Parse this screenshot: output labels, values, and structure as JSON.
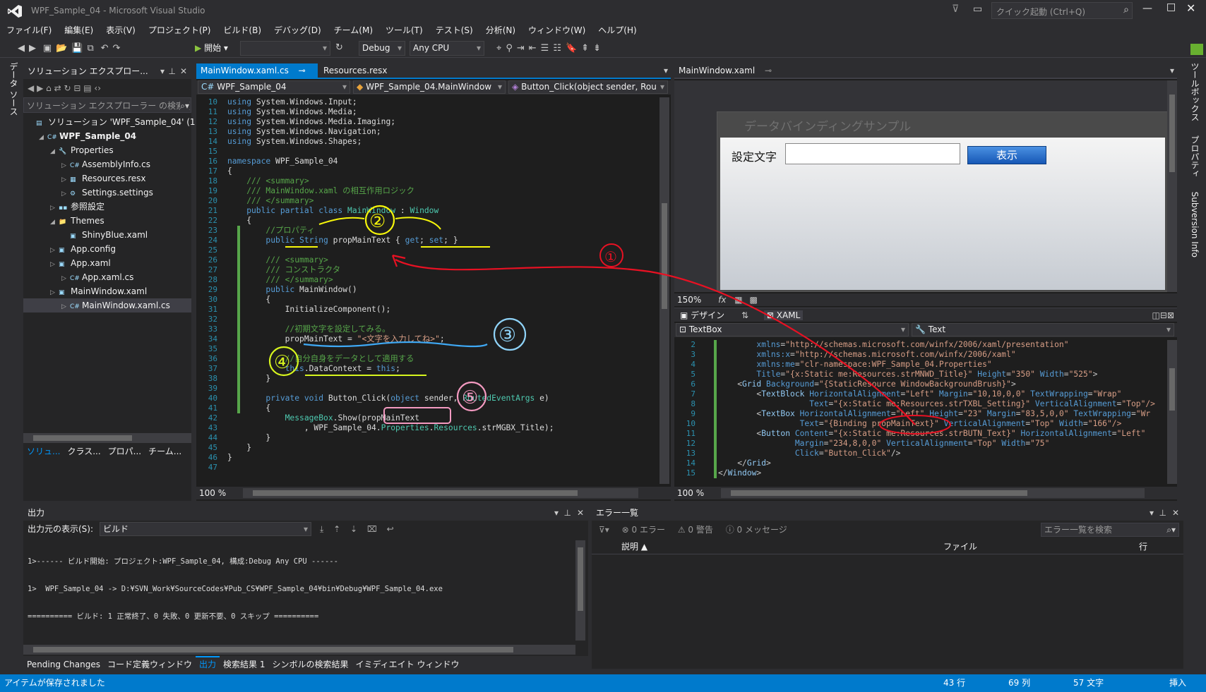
{
  "window": {
    "title": "WPF_Sample_04 - Microsoft Visual Studio",
    "quick_launch": "クイック起動 (Ctrl+Q)"
  },
  "menu": [
    "ファイル(F)",
    "編集(E)",
    "表示(V)",
    "プロジェクト(P)",
    "ビルド(B)",
    "デバッグ(D)",
    "チーム(M)",
    "ツール(T)",
    "テスト(S)",
    "分析(N)",
    "ウィンドウ(W)",
    "ヘルプ(H)"
  ],
  "toolbar": {
    "start_label": "開始",
    "config": "Debug",
    "platform": "Any CPU"
  },
  "left_rail": {
    "label": "データ ソース"
  },
  "right_rail": {
    "toolbox": "ツールボックス",
    "properties": "プロパティ",
    "svn": "Subversion Info"
  },
  "solution_explorer": {
    "title": "ソリューション エクスプロー...",
    "search_placeholder": "ソリューション エクスプローラー の検索 (Ctrl+;)",
    "items": [
      {
        "label": "ソリューション 'WPF_Sample_04' (1 プロジェクト)",
        "indent": 0,
        "icon": "solution-icon"
      },
      {
        "label": "WPF_Sample_04",
        "indent": 1,
        "icon": "csharp-project-icon",
        "bold": true
      },
      {
        "label": "Properties",
        "indent": 2,
        "icon": "wrench-icon"
      },
      {
        "label": "AssemblyInfo.cs",
        "indent": 3,
        "icon": "cs-file-icon"
      },
      {
        "label": "Resources.resx",
        "indent": 3,
        "icon": "resx-file-icon"
      },
      {
        "label": "Settings.settings",
        "indent": 3,
        "icon": "settings-file-icon"
      },
      {
        "label": "参照設定",
        "indent": 2,
        "icon": "references-icon"
      },
      {
        "label": "Themes",
        "indent": 2,
        "icon": "folder-icon"
      },
      {
        "label": "ShinyBlue.xaml",
        "indent": 3,
        "icon": "xaml-file-icon"
      },
      {
        "label": "App.config",
        "indent": 2,
        "icon": "config-file-icon"
      },
      {
        "label": "App.xaml",
        "indent": 2,
        "icon": "xaml-file-icon"
      },
      {
        "label": "App.xaml.cs",
        "indent": 3,
        "icon": "cs-file-icon"
      },
      {
        "label": "MainWindow.xaml",
        "indent": 2,
        "icon": "xaml-file-icon"
      },
      {
        "label": "MainWindow.xaml.cs",
        "indent": 3,
        "icon": "cs-file-icon",
        "selected": true
      }
    ],
    "bottom_tabs": [
      "ソリュ...",
      "クラス...",
      "プロパ...",
      "チーム..."
    ]
  },
  "editor": {
    "tabs": [
      {
        "label": "MainWindow.xaml.cs",
        "active": true
      },
      {
        "label": "Resources.resx",
        "active": false
      }
    ],
    "nav": {
      "project": "WPF_Sample_04",
      "type": "WPF_Sample_04.MainWindow",
      "member": "Button_Click(object sender, Rou"
    },
    "zoom": "100 %",
    "lines": [
      {
        "n": "10",
        "t": [
          [
            "kw",
            "using"
          ],
          [
            "tx",
            " System.Windows.Input;"
          ]
        ]
      },
      {
        "n": "11",
        "t": [
          [
            "kw",
            "using"
          ],
          [
            "tx",
            " System.Windows.Media;"
          ]
        ]
      },
      {
        "n": "12",
        "t": [
          [
            "kw",
            "using"
          ],
          [
            "tx",
            " System.Windows.Media.Imaging;"
          ]
        ]
      },
      {
        "n": "13",
        "t": [
          [
            "kw",
            "using"
          ],
          [
            "tx",
            " System.Windows.Navigation;"
          ]
        ]
      },
      {
        "n": "14",
        "t": [
          [
            "kw",
            "using"
          ],
          [
            "tx",
            " System.Windows.Shapes;"
          ]
        ]
      },
      {
        "n": "15",
        "t": []
      },
      {
        "n": "16",
        "t": [
          [
            "kw",
            "namespace"
          ],
          [
            "tx",
            " WPF_Sample_04"
          ]
        ]
      },
      {
        "n": "17",
        "t": [
          [
            "tx",
            "{"
          ]
        ]
      },
      {
        "n": "18",
        "t": [
          [
            "cm",
            "    /// <summary>"
          ]
        ]
      },
      {
        "n": "19",
        "t": [
          [
            "cm",
            "    /// MainWindow.xaml の相互作用ロジック"
          ]
        ]
      },
      {
        "n": "20",
        "t": [
          [
            "cm",
            "    /// </summary>"
          ]
        ]
      },
      {
        "n": "21",
        "t": [
          [
            "kw",
            "    public partial class "
          ],
          [
            "ty",
            "MainWindow"
          ],
          [
            "tx",
            " : "
          ],
          [
            "ty",
            "Window"
          ]
        ]
      },
      {
        "n": "22",
        "t": [
          [
            "tx",
            "    {"
          ]
        ]
      },
      {
        "n": "23",
        "t": [
          [
            "cm",
            "        //プロパティ"
          ]
        ]
      },
      {
        "n": "24",
        "t": [
          [
            "kw",
            "        public "
          ],
          [
            "kw",
            "String"
          ],
          [
            "tx",
            " propMainText { "
          ],
          [
            "kw",
            "get"
          ],
          [
            "tx",
            "; "
          ],
          [
            "kw",
            "set"
          ],
          [
            "tx",
            "; }"
          ]
        ]
      },
      {
        "n": "25",
        "t": []
      },
      {
        "n": "26",
        "t": [
          [
            "cm",
            "        /// <summary>"
          ]
        ]
      },
      {
        "n": "27",
        "t": [
          [
            "cm",
            "        /// コンストラクタ"
          ]
        ]
      },
      {
        "n": "28",
        "t": [
          [
            "cm",
            "        /// </summary>"
          ]
        ]
      },
      {
        "n": "29",
        "t": [
          [
            "kw",
            "        public "
          ],
          [
            "tx",
            "MainWindow()"
          ]
        ]
      },
      {
        "n": "30",
        "t": [
          [
            "tx",
            "        {"
          ]
        ]
      },
      {
        "n": "31",
        "t": [
          [
            "tx",
            "            InitializeComponent();"
          ]
        ]
      },
      {
        "n": "32",
        "t": []
      },
      {
        "n": "33",
        "t": [
          [
            "cm",
            "            //初期文字を設定してみる。"
          ]
        ]
      },
      {
        "n": "34",
        "t": [
          [
            "tx",
            "            propMainText = "
          ],
          [
            "st",
            "\"<文字を入力してね>\""
          ],
          [
            "tx",
            ";"
          ]
        ]
      },
      {
        "n": "35",
        "t": []
      },
      {
        "n": "36",
        "t": [
          [
            "cm",
            "            //自分自身をデータとして適用する"
          ]
        ]
      },
      {
        "n": "37",
        "t": [
          [
            "kw",
            "            this"
          ],
          [
            "tx",
            ".DataContext = "
          ],
          [
            "kw",
            "this"
          ],
          [
            "tx",
            ";"
          ]
        ]
      },
      {
        "n": "38",
        "t": [
          [
            "tx",
            "        }"
          ]
        ]
      },
      {
        "n": "39",
        "t": []
      },
      {
        "n": "40",
        "t": [
          [
            "kw",
            "        private void "
          ],
          [
            "tx",
            "Button_Click("
          ],
          [
            "kw",
            "object"
          ],
          [
            "tx",
            " sender, "
          ],
          [
            "ty",
            "RoutedEventArgs"
          ],
          [
            "tx",
            " e)"
          ]
        ]
      },
      {
        "n": "41",
        "t": [
          [
            "tx",
            "        {"
          ]
        ]
      },
      {
        "n": "42",
        "t": [
          [
            "ty",
            "            MessageBox"
          ],
          [
            "tx",
            ".Show(propMainText"
          ]
        ]
      },
      {
        "n": "43",
        "t": [
          [
            "tx",
            "                , WPF_Sample_04."
          ],
          [
            "ty",
            "Properties"
          ],
          [
            "tx",
            "."
          ],
          [
            "ty",
            "Resources"
          ],
          [
            "tx",
            ".strMGBX_Title);"
          ]
        ]
      },
      {
        "n": "44",
        "t": [
          [
            "tx",
            "        }"
          ]
        ]
      },
      {
        "n": "45",
        "t": [
          [
            "tx",
            "    }"
          ]
        ]
      },
      {
        "n": "46",
        "t": [
          [
            "tx",
            "}"
          ]
        ]
      },
      {
        "n": "47",
        "t": []
      }
    ]
  },
  "designer": {
    "tab": "MainWindow.xaml",
    "window_title": "データバインディングサンプル",
    "label": "設定文字",
    "button": "表示",
    "zoom": "150%",
    "fx": "fx",
    "design_tab": "デザイン",
    "xaml_tab": "XAML",
    "element_combo": "TextBox",
    "property_combo": "Text",
    "xaml_zoom": "100 %",
    "xaml_lines": [
      {
        "n": "2",
        "t": [
          [
            "xa",
            "        xmlns"
          ],
          [
            "xv",
            "="
          ],
          [
            "xn",
            "\"http://schemas.microsoft.com/winfx/2006/xaml/presentation\""
          ]
        ]
      },
      {
        "n": "3",
        "t": [
          [
            "xa",
            "        xmlns:x"
          ],
          [
            "xv",
            "="
          ],
          [
            "xn",
            "\"http://schemas.microsoft.com/winfx/2006/xaml\""
          ]
        ]
      },
      {
        "n": "4",
        "t": [
          [
            "xa",
            "        xmlns:me"
          ],
          [
            "xv",
            "="
          ],
          [
            "xn",
            "\"clr-namespace:WPF_Sample_04.Properties\""
          ]
        ]
      },
      {
        "n": "5",
        "t": [
          [
            "xa",
            "        Title"
          ],
          [
            "xv",
            "="
          ],
          [
            "xn",
            "\"{x:Static me:Resources.strMNWD_Title}\""
          ],
          [
            "xa",
            " Height"
          ],
          [
            "xv",
            "="
          ],
          [
            "xn",
            "\"350\""
          ],
          [
            "xa",
            " Width"
          ],
          [
            "xv",
            "="
          ],
          [
            "xn",
            "\"525\""
          ],
          [
            "xv",
            ">"
          ]
        ]
      },
      {
        "n": "6",
        "t": [
          [
            "xv",
            "    <"
          ],
          [
            "xt",
            "Grid"
          ],
          [
            "xa",
            " Background"
          ],
          [
            "xv",
            "="
          ],
          [
            "xn",
            "\"{StaticResource WindowBackgroundBrush}\""
          ],
          [
            "xv",
            ">"
          ]
        ]
      },
      {
        "n": "7",
        "t": [
          [
            "xv",
            "        <"
          ],
          [
            "xt",
            "TextBlock"
          ],
          [
            "xa",
            " HorizontalAlignment"
          ],
          [
            "xv",
            "="
          ],
          [
            "xn",
            "\"Left\""
          ],
          [
            "xa",
            " Margin"
          ],
          [
            "xv",
            "="
          ],
          [
            "xn",
            "\"10,10,0,0\""
          ],
          [
            "xa",
            " TextWrapping"
          ],
          [
            "xv",
            "="
          ],
          [
            "xn",
            "\"Wrap\""
          ]
        ]
      },
      {
        "n": "8",
        "t": [
          [
            "xa",
            "                   Text"
          ],
          [
            "xv",
            "="
          ],
          [
            "xn",
            "\"{x:Static me:Resources.strTXBL_Setting}\""
          ],
          [
            "xa",
            " VerticalAlignment"
          ],
          [
            "xv",
            "="
          ],
          [
            "xn",
            "\"Top\"/>"
          ]
        ]
      },
      {
        "n": "9",
        "t": [
          [
            "xv",
            "        <"
          ],
          [
            "xt",
            "TextBox"
          ],
          [
            "xa",
            " HorizontalAlignment"
          ],
          [
            "xv",
            "="
          ],
          [
            "xn",
            "\"Left\""
          ],
          [
            "xa",
            " Height"
          ],
          [
            "xv",
            "="
          ],
          [
            "xn",
            "\"23\""
          ],
          [
            "xa",
            " Margin"
          ],
          [
            "xv",
            "="
          ],
          [
            "xn",
            "\"83,5,0,0\""
          ],
          [
            "xa",
            " TextWrapping"
          ],
          [
            "xv",
            "="
          ],
          [
            "xn",
            "\"Wr"
          ]
        ]
      },
      {
        "n": "10",
        "t": [
          [
            "xa",
            "                 Text"
          ],
          [
            "xv",
            "="
          ],
          [
            "xn",
            "\"{Binding propMainText}\""
          ],
          [
            "xa",
            " VerticalAlignment"
          ],
          [
            "xv",
            "="
          ],
          [
            "xn",
            "\"Top\""
          ],
          [
            "xa",
            " Width"
          ],
          [
            "xv",
            "="
          ],
          [
            "xn",
            "\"166\"/>"
          ]
        ]
      },
      {
        "n": "11",
        "t": [
          [
            "xv",
            "        <"
          ],
          [
            "xt",
            "Button"
          ],
          [
            "xa",
            " Content"
          ],
          [
            "xv",
            "="
          ],
          [
            "xn",
            "\"{x:Static me:Resources.strBUTN_Text}\""
          ],
          [
            "xa",
            " HorizontalAlignment"
          ],
          [
            "xv",
            "="
          ],
          [
            "xn",
            "\"Left\""
          ]
        ]
      },
      {
        "n": "12",
        "t": [
          [
            "xa",
            "                Margin"
          ],
          [
            "xv",
            "="
          ],
          [
            "xn",
            "\"234,8,0,0\""
          ],
          [
            "xa",
            " VerticalAlignment"
          ],
          [
            "xv",
            "="
          ],
          [
            "xn",
            "\"Top\""
          ],
          [
            "xa",
            " Width"
          ],
          [
            "xv",
            "="
          ],
          [
            "xn",
            "\"75\""
          ]
        ]
      },
      {
        "n": "13",
        "t": [
          [
            "xa",
            "                Click"
          ],
          [
            "xv",
            "="
          ],
          [
            "xn",
            "\"Button_Click\""
          ],
          [
            "xv",
            "/>"
          ]
        ]
      },
      {
        "n": "14",
        "t": [
          [
            "xv",
            "    </"
          ],
          [
            "xt",
            "Grid"
          ],
          [
            "xv",
            ">"
          ]
        ]
      },
      {
        "n": "15",
        "t": [
          [
            "xv",
            "</"
          ],
          [
            "xt",
            "Window"
          ],
          [
            "xv",
            ">"
          ]
        ]
      }
    ]
  },
  "output": {
    "title": "出力",
    "source_label": "出力元の表示(S):",
    "source_value": "ビルド",
    "lines": [
      "1>------ ビルド開始: プロジェクト:WPF_Sample_04, 構成:Debug Any CPU ------",
      "1>  WPF_Sample_04 -> D:¥SVN_Work¥SourceCodes¥Pub_CS¥WPF_Sample_04¥bin¥Debug¥WPF_Sample_04.exe",
      "========== ビルド: 1 正常終了、0 失敗、0 更新不要、0 スキップ =========="
    ]
  },
  "errors": {
    "title": "エラー一覧",
    "errors": "0 エラー",
    "warnings": "0 警告",
    "messages": "0 メッセージ",
    "search": "エラー一覧を検索",
    "columns": [
      "説明",
      "ファイル",
      "行"
    ]
  },
  "bottom_tabs": [
    {
      "label": "Pending Changes",
      "active": false
    },
    {
      "label": "コード定義ウィンドウ",
      "active": false
    },
    {
      "label": "出力",
      "active": true
    },
    {
      "label": "検索結果 1",
      "active": false
    },
    {
      "label": "シンボルの検索結果",
      "active": false
    },
    {
      "label": "イミディエイト ウィンドウ",
      "active": false
    }
  ],
  "statusbar": {
    "message": "アイテムが保存されました",
    "line": "43 行",
    "col": "69 列",
    "chars": "57 文字",
    "mode": "挿入",
    "color": "#007acc"
  },
  "annotations": [
    {
      "label": "①",
      "color": "#e81123"
    },
    {
      "label": "②",
      "color": "#f7f70a"
    },
    {
      "label": "③",
      "color": "#8fd3f8"
    },
    {
      "label": "④",
      "color": "#d7f51e"
    },
    {
      "label": "⑤",
      "color": "#f49ac1"
    }
  ]
}
